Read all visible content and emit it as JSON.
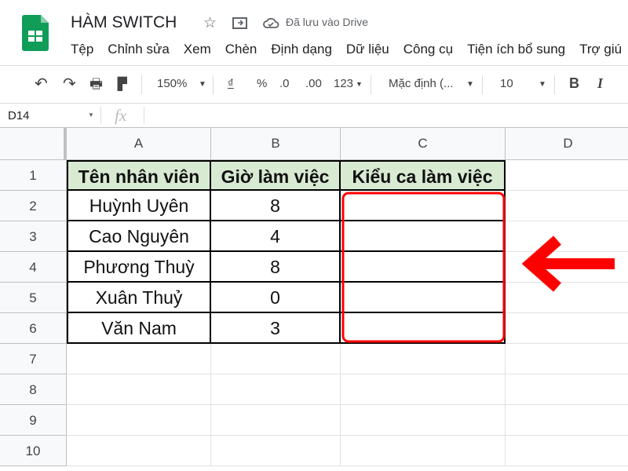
{
  "app": {
    "title": "HÀM SWITCH",
    "saved_status": "Đã lưu vào Drive",
    "icons": [
      "sheets-logo",
      "star-icon",
      "move-folder-icon",
      "cloud-saved-icon"
    ]
  },
  "menu": [
    "Tệp",
    "Chỉnh sửa",
    "Xem",
    "Chèn",
    "Định dạng",
    "Dữ liệu",
    "Công cụ",
    "Tiện ích bổ sung",
    "Trợ giú"
  ],
  "toolbar": {
    "zoom": "150%",
    "currency": "₫",
    "percent": "%",
    "dec_decrease": ".0",
    "dec_increase": ".00",
    "number_format": "123",
    "font": "Mặc định (...",
    "font_size": "10",
    "bold": "B",
    "italic": "I"
  },
  "formula_bar": {
    "cell_ref": "D14",
    "fx": "fx",
    "value": ""
  },
  "columns": [
    "A",
    "B",
    "C",
    "D"
  ],
  "rows": [
    "1",
    "2",
    "3",
    "4",
    "5",
    "6",
    "7",
    "8",
    "9",
    "10"
  ],
  "table": {
    "headers": [
      "Tên nhân viên",
      "Giờ làm việc",
      "Kiểu ca làm việc"
    ],
    "data": [
      [
        "Huỳnh Uyên",
        "8",
        ""
      ],
      [
        "Cao Nguyên",
        "4",
        ""
      ],
      [
        "Phương Thuỳ",
        "8",
        ""
      ],
      [
        "Xuân Thuỷ",
        "0",
        ""
      ],
      [
        "Văn Nam",
        "3",
        ""
      ]
    ]
  },
  "annotation": {
    "color": "#ff0000",
    "highlight": "C2:C6",
    "arrow": "left"
  }
}
